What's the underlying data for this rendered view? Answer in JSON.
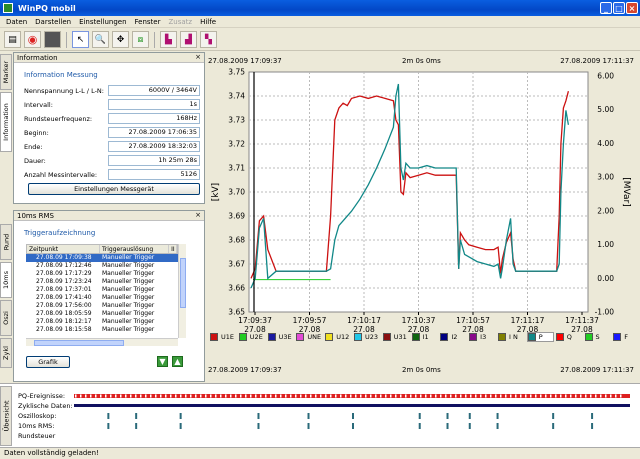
{
  "window": {
    "title": "WinPQ mobil"
  },
  "menu": [
    "Daten",
    "Darstellen",
    "Einstellungen",
    "Fenster",
    "Zusatz",
    "Hilfe"
  ],
  "left_tabs": {
    "top": [
      "Marker",
      "Information"
    ],
    "middle": [
      "Rund",
      "10ms",
      "Oszi",
      "Zykl"
    ],
    "bottom": "Übersicht"
  },
  "info_panel": {
    "title": "Information",
    "section": "Information Messung",
    "rows": [
      {
        "label": "Nennspannung L-L / L-N:",
        "value": "6000V / 3464V"
      },
      {
        "label": "Intervall:",
        "value": "1s"
      },
      {
        "label": "Rundsteuerfrequenz:",
        "value": "168Hz"
      },
      {
        "label": "Beginn:",
        "value": "27.08.2009 17:06:35"
      },
      {
        "label": "Ende:",
        "value": "27.08.2009 18:32:03"
      },
      {
        "label": "Dauer:",
        "value": "1h 25m 28s"
      },
      {
        "label": "Anzahl Messintervalle:",
        "value": "5126"
      }
    ],
    "button": "Einstellungen Messgerät"
  },
  "rms_panel": {
    "title": "10ms RMS",
    "section": "Triggeraufzeichnung",
    "columns": [
      "Zeitpunkt",
      "Triggerauslösung",
      "II"
    ],
    "rows": [
      [
        "27.08.09 17:09:38",
        "Manueller Trigger"
      ],
      [
        "27.08.09 17:12:46",
        "Manueller Trigger"
      ],
      [
        "27.08.09 17:17:29",
        "Manueller Trigger"
      ],
      [
        "27.08.09 17:23:24",
        "Manueller Trigger"
      ],
      [
        "27.08.09 17:37:01",
        "Manueller Trigger"
      ],
      [
        "27.08.09 17:41:40",
        "Manueller Trigger"
      ],
      [
        "27.08.09 17:56:00",
        "Manueller Trigger"
      ],
      [
        "27.08.09 18:05:59",
        "Manueller Trigger"
      ],
      [
        "27.08.09 18:12:17",
        "Manueller Trigger"
      ],
      [
        "27.08.09 18:15:58",
        "Manueller Trigger"
      ]
    ],
    "selected_row": 0,
    "button": "Grafik"
  },
  "chart_header": {
    "left": "27.08.2009 17:09:37",
    "center": "2m 0s 0ms",
    "right": "27.08.2009 17:11:37"
  },
  "chart_footer": {
    "left": "27.08.2009 17:09:37",
    "center": "2m 0s 0ms",
    "right": "27.08.2009 17:11:37"
  },
  "chart_data": {
    "type": "line",
    "ylabel_left": "[kV]",
    "ylabel_right": "[MVar]",
    "ylim_left": [
      3.65,
      3.75
    ],
    "ylim_right": [
      -1.0,
      6.0
    ],
    "yticks_left": [
      "3.75",
      "3.74",
      "3.73",
      "3.72",
      "3.71",
      "3.70",
      "3.69",
      "3.68",
      "3.67",
      "3.66",
      "3.65"
    ],
    "yticks_right": [
      "6.00",
      "5.00",
      "4.00",
      "3.00",
      "2.00",
      "1.00",
      "0.00",
      "-1.00"
    ],
    "xticks": [
      [
        "17:09:37",
        "27.08"
      ],
      [
        "17:09:57",
        "27.08"
      ],
      [
        "17:10:17",
        "27.08"
      ],
      [
        "17:10:37",
        "27.08"
      ],
      [
        "17:10:57",
        "27.08"
      ],
      [
        "17:11:17",
        "27.08"
      ],
      [
        "17:11:37",
        "27.08"
      ]
    ],
    "grid": true,
    "series": [
      {
        "name": "U1E",
        "color": "#cc1111",
        "points": [
          [
            0,
            3.664
          ],
          [
            0.5,
            3.668
          ],
          [
            1,
            3.688
          ],
          [
            1.5,
            3.69
          ],
          [
            2,
            3.676
          ],
          [
            3,
            3.667
          ],
          [
            4,
            3.667
          ],
          [
            5,
            3.667
          ],
          [
            6,
            3.667
          ],
          [
            7,
            3.667
          ],
          [
            8,
            3.667
          ],
          [
            9,
            3.667
          ],
          [
            9.5,
            3.69
          ],
          [
            10,
            3.73
          ],
          [
            10.5,
            3.735
          ],
          [
            11,
            3.737
          ],
          [
            11.5,
            3.736
          ],
          [
            12,
            3.739
          ],
          [
            13,
            3.74
          ],
          [
            14,
            3.739
          ],
          [
            15,
            3.74
          ],
          [
            16,
            3.739
          ],
          [
            17,
            3.738
          ],
          [
            17.3,
            3.73
          ],
          [
            17.6,
            3.728
          ],
          [
            17.9,
            3.7
          ],
          [
            18.2,
            3.699
          ],
          [
            18.5,
            3.708
          ],
          [
            19,
            3.706
          ],
          [
            20,
            3.707
          ],
          [
            21,
            3.708
          ],
          [
            22,
            3.707
          ],
          [
            23,
            3.707
          ],
          [
            24,
            3.707
          ],
          [
            24.5,
            3.707
          ],
          [
            24.8,
            3.668
          ],
          [
            25,
            3.683
          ],
          [
            25.5,
            3.68
          ],
          [
            26,
            3.678
          ],
          [
            27,
            3.677
          ],
          [
            28,
            3.676
          ],
          [
            29,
            3.676
          ],
          [
            29.5,
            3.677
          ],
          [
            29.8,
            3.666
          ],
          [
            30,
            3.672
          ],
          [
            30.5,
            3.679
          ],
          [
            31,
            3.683
          ],
          [
            31.3,
            3.672
          ],
          [
            31.6,
            3.667
          ],
          [
            32,
            3.667
          ],
          [
            33,
            3.667
          ],
          [
            34,
            3.667
          ],
          [
            35,
            3.667
          ],
          [
            36,
            3.667
          ],
          [
            36.5,
            3.667
          ],
          [
            36.8,
            3.69
          ],
          [
            37,
            3.72
          ],
          [
            37.3,
            3.735
          ],
          [
            37.6,
            3.738
          ],
          [
            37.9,
            3.742
          ]
        ]
      },
      {
        "name": "P",
        "color": "#118888",
        "points": [
          [
            0,
            3.66
          ],
          [
            0.5,
            3.664
          ],
          [
            1,
            3.685
          ],
          [
            1.5,
            3.689
          ],
          [
            2,
            3.664
          ],
          [
            3,
            3.667
          ],
          [
            4,
            3.667
          ],
          [
            5,
            3.667
          ],
          [
            6,
            3.667
          ],
          [
            7,
            3.667
          ],
          [
            8,
            3.667
          ],
          [
            9,
            3.667
          ],
          [
            9.5,
            3.668
          ],
          [
            10,
            3.68
          ],
          [
            10.5,
            3.686
          ],
          [
            11,
            3.688
          ],
          [
            12,
            3.692
          ],
          [
            13,
            3.697
          ],
          [
            14,
            3.703
          ],
          [
            15,
            3.71
          ],
          [
            16,
            3.718
          ],
          [
            17,
            3.727
          ],
          [
            17.3,
            3.74
          ],
          [
            17.6,
            3.745
          ],
          [
            17.9,
            3.71
          ],
          [
            18.2,
            3.705
          ],
          [
            18.5,
            3.712
          ],
          [
            19,
            3.71
          ],
          [
            20,
            3.71
          ],
          [
            21,
            3.711
          ],
          [
            22,
            3.71
          ],
          [
            23,
            3.71
          ],
          [
            24,
            3.71
          ],
          [
            24.5,
            3.71
          ],
          [
            24.8,
            3.668
          ],
          [
            25,
            3.68
          ],
          [
            25.5,
            3.674
          ],
          [
            26,
            3.673
          ],
          [
            27,
            3.671
          ],
          [
            28,
            3.67
          ],
          [
            29,
            3.669
          ],
          [
            29.5,
            3.67
          ],
          [
            29.8,
            3.664
          ],
          [
            30,
            3.668
          ],
          [
            30.5,
            3.68
          ],
          [
            31,
            3.689
          ],
          [
            31.3,
            3.67
          ],
          [
            31.6,
            3.667
          ],
          [
            32,
            3.667
          ],
          [
            33,
            3.667
          ],
          [
            34,
            3.667
          ],
          [
            35,
            3.667
          ],
          [
            36,
            3.667
          ],
          [
            36.5,
            3.667
          ],
          [
            36.8,
            3.67
          ],
          [
            37,
            3.7
          ],
          [
            37.3,
            3.72
          ],
          [
            37.6,
            3.734
          ],
          [
            37.9,
            3.728
          ]
        ]
      }
    ]
  },
  "legend": [
    {
      "label": "U1E",
      "color": "#cc1111"
    },
    {
      "label": "U2E",
      "color": "#22cc22"
    },
    {
      "label": "U3E",
      "color": "#1a1aa0"
    },
    {
      "label": "UNE",
      "color": "#e24bd6"
    },
    {
      "label": "U12",
      "color": "#f0e020"
    },
    {
      "label": "U23",
      "color": "#22c8e8"
    },
    {
      "label": "U31",
      "color": "#8a1010"
    },
    {
      "label": "I1",
      "color": "#116611"
    },
    {
      "label": "I2",
      "color": "#000080"
    },
    {
      "label": "I3",
      "color": "#8a0a8a"
    },
    {
      "label": "I N",
      "color": "#808000"
    },
    {
      "label": "P",
      "color": "#118888"
    },
    {
      "label": "Q",
      "color": "#ff0000"
    },
    {
      "label": "S",
      "color": "#22cc22"
    },
    {
      "label": "F",
      "color": "#1a1aff"
    }
  ],
  "bottom_panel": {
    "labels": [
      "PQ-Ereignisse:",
      "Zyklische Daten:",
      "Oszilloskop:",
      "10ms RMS:",
      "Rundsteuer"
    ],
    "marker_positions": [
      0.06,
      0.11,
      0.19,
      0.33,
      0.42,
      0.5,
      0.62,
      0.67,
      0.71,
      0.76,
      0.86,
      0.93
    ]
  },
  "status": "Daten vollständig geladen!"
}
